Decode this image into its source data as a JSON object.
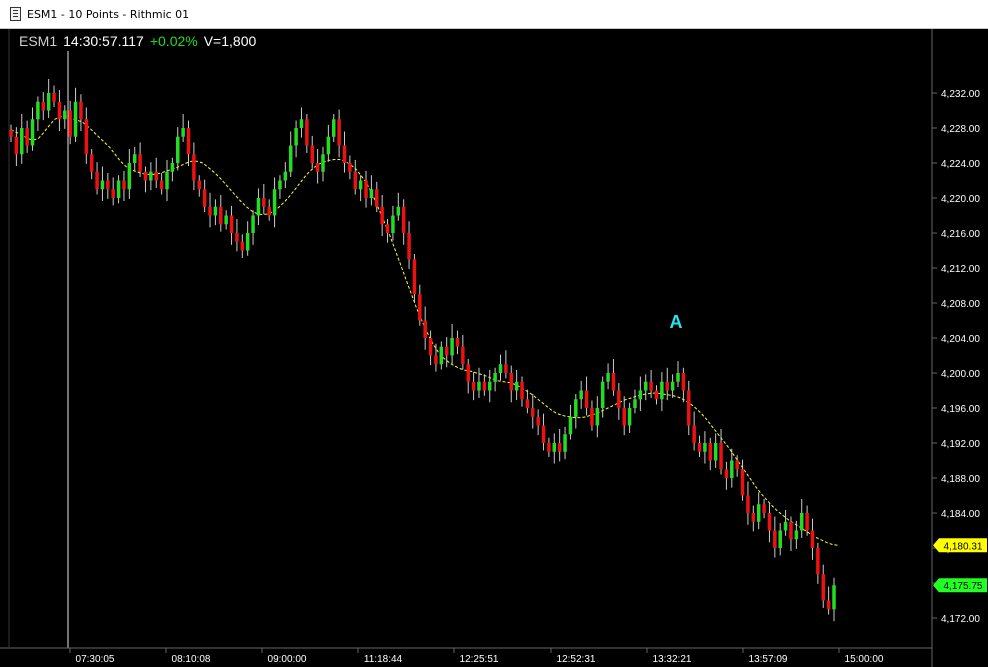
{
  "window": {
    "title": "ESM1 - 10 Points - Rithmic 01"
  },
  "quote": {
    "symbol": "ESM1",
    "time": "14:30:57.117",
    "change": "+0.02%",
    "volume": "V=1,800"
  },
  "annotation": {
    "label": "A"
  },
  "colors": {
    "up": "#22dd22",
    "down": "#ee1111",
    "wick": "#cccccc",
    "ma": "#ffff33",
    "axis": "#666666",
    "annotation": "#22e6f2",
    "ma_tag": "#ffff00",
    "last_tag": "#22ff22"
  },
  "chart_data": {
    "type": "candlestick",
    "ylim": [
      4170,
      4236
    ],
    "y_ticks": [
      "4,232.00",
      "4,228.00",
      "4,224.00",
      "4,220.00",
      "4,216.00",
      "4,212.00",
      "4,208.00",
      "4,204.00",
      "4,200.00",
      "4,196.00",
      "4,192.00",
      "4,188.00",
      "4,184.00",
      "4,180.00",
      "4,176.00",
      "4,172.00"
    ],
    "x_ticks": [
      "07:30:05",
      "08:10:08",
      "09:00:00",
      "11:18:44",
      "12:25:51",
      "12:52:31",
      "13:32:21",
      "13:57:09",
      "15:00:00"
    ],
    "ma_last": "4,180.31",
    "last_price": "4,175.75",
    "closes": [
      4227,
      4225,
      4228,
      4226,
      4229,
      4231,
      4230,
      4232,
      4231,
      4229,
      4230,
      4227,
      4231,
      4229,
      4225,
      4223,
      4221,
      4222,
      4221,
      4220,
      4222,
      4221,
      4224,
      4225,
      4223,
      4222,
      4223,
      4222,
      4221,
      4223,
      4224,
      4227,
      4228,
      4225,
      4222,
      4221,
      4219,
      4218,
      4219,
      4217,
      4218,
      4216,
      4215,
      4214,
      4216,
      4218,
      4220,
      4219,
      4218,
      4221,
      4222,
      4223,
      4226,
      4228,
      4229,
      4226,
      4224,
      4223,
      4225,
      4227,
      4229,
      4226,
      4224,
      4223,
      4221,
      4222,
      4220,
      4221,
      4219,
      4217,
      4216,
      4218,
      4219,
      4216,
      4213,
      4209,
      4206,
      4204,
      4202,
      4201,
      4203,
      4202,
      4204,
      4203,
      4201,
      4199,
      4198,
      4199,
      4198,
      4199,
      4200,
      4201,
      4200,
      4198,
      4199,
      4197,
      4196,
      4195,
      4194,
      4192,
      4191,
      4192,
      4191,
      4193,
      4195,
      4197,
      4198,
      4196,
      4194,
      4196,
      4199,
      4200,
      4198,
      4196,
      4194,
      4196,
      4197,
      4198,
      4199,
      4198,
      4197,
      4199,
      4198,
      4199,
      4200,
      4198,
      4194,
      4192,
      4191,
      4192,
      4190,
      4192,
      4189,
      4188,
      4190,
      4189,
      4186,
      4184,
      4183,
      4185,
      4184,
      4182,
      4180,
      4182,
      4183,
      4181,
      4182,
      4184,
      4182,
      4180,
      4177,
      4174,
      4173,
      4175.75
    ],
    "ma_values": [
      4227.8,
      4227.5,
      4227.2,
      4226.8,
      4226.6,
      4226.8,
      4227.5,
      4228.3,
      4229,
      4229.3,
      4229.3,
      4229.1,
      4228.9,
      4228.7,
      4228.2,
      4227.6,
      4227,
      4226.4,
      4225.8,
      4225,
      4224.2,
      4223.6,
      4223.2,
      4223,
      4222.8,
      4222.7,
      4222.7,
      4222.8,
      4223,
      4223.2,
      4223.4,
      4223.7,
      4224,
      4224.2,
      4224.2,
      4224,
      4223.5,
      4223,
      4222.4,
      4221.7,
      4221,
      4220.3,
      4219.6,
      4219,
      4218.5,
      4218.2,
      4218.1,
      4218.2,
      4218.5,
      4219,
      4219.6,
      4220.3,
      4221.1,
      4221.9,
      4222.7,
      4223.3,
      4223.8,
      4224.1,
      4224.3,
      4224.4,
      4224.4,
      4224.2,
      4223.8,
      4223.3,
      4222.5,
      4221.6,
      4220.4,
      4219,
      4217.5,
      4216,
      4214.3,
      4212.6,
      4210.9,
      4209.2,
      4207.5,
      4206,
      4204.6,
      4203.4,
      4202.4,
      4201.7,
      4201.2,
      4200.8,
      4200.5,
      4200.3,
      4200.2,
      4200,
      4199.8,
      4199.6,
      4199.3,
      4199.1,
      4199,
      4198.9,
      4198.7,
      4198.4,
      4198,
      4197.6,
      4197.1,
      4196.6,
      4196.1,
      4195.6,
      4195.3,
      4195.1,
      4195,
      4194.9,
      4194.9,
      4195,
      4195.2,
      4195.4,
      4195.7,
      4196,
      4196.3,
      4196.6,
      4196.9,
      4197.1,
      4197.3,
      4197.5,
      4197.6,
      4197.7,
      4197.7,
      4197.6,
      4197.5,
      4197.4,
      4197.2,
      4196.9,
      4196.5,
      4196,
      4195.4,
      4194.7,
      4193.9,
      4193.1,
      4192.3,
      4191.5,
      4190.6,
      4189.7,
      4188.8,
      4187.9,
      4187,
      4186.2,
      4185.5,
      4184.8,
      4184.2,
      4183.7,
      4183.2,
      4182.8,
      4182.4,
      4182,
      4181.6,
      4181.2,
      4180.9,
      4180.6,
      4180.4,
      4180.31
    ]
  }
}
